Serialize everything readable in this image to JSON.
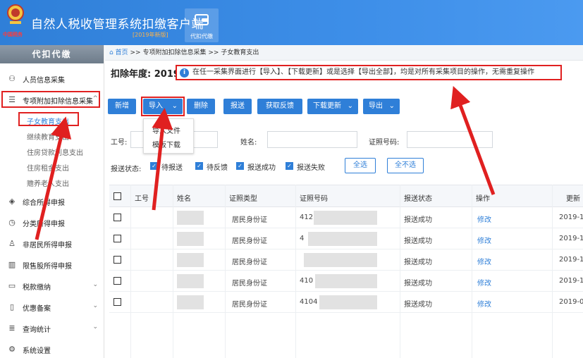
{
  "header": {
    "emblem_text": "中国税务",
    "title": "自然人税收管理系统扣缴客户端",
    "version_tag": "[2019年新版]",
    "module_label": "代扣代缴"
  },
  "sidebar": {
    "heading": "代扣代缴",
    "items": [
      {
        "label": "人员信息采集",
        "icon": "person-icon"
      },
      {
        "label": "专项附加扣除信息采集",
        "icon": "list-icon",
        "expanded": true
      },
      {
        "label": "综合所得申报",
        "icon": "layers-icon"
      },
      {
        "label": "分类所得申报",
        "icon": "clock-icon"
      },
      {
        "label": "非居民所得申报",
        "icon": "person-outline-icon"
      },
      {
        "label": "限售股所得申报",
        "icon": "bar-chart-icon"
      },
      {
        "label": "税款缴纳",
        "icon": "folder-icon"
      },
      {
        "label": "优惠备案",
        "icon": "document-icon"
      },
      {
        "label": "查询统计",
        "icon": "query-icon"
      },
      {
        "label": "系统设置",
        "icon": "gear-icon"
      }
    ],
    "sub_items": [
      "子女教育支出",
      "继续教育支出",
      "住房贷款利息支出",
      "住房租金支出",
      "赡养老人支出"
    ]
  },
  "breadcrumb": {
    "home": "首页",
    "sep1": ">>",
    "section": "专项附加扣除信息采集",
    "sep2": ">>",
    "page": "子女教育支出"
  },
  "year_label": "扣除年度: 2019",
  "notice": "在任一采集界面进行【导入】、【下载更新】或是选择【导出全部】，均是对所有采集项目的操作，无需重复操作",
  "toolbar": {
    "add": "新增",
    "import": "导入",
    "delete": "删除",
    "submit": "报送",
    "feedback": "获取反馈",
    "download": "下载更新",
    "export": "导出"
  },
  "import_menu": [
    "导入文件",
    "模板下载"
  ],
  "filters": {
    "emp_no_label": "工号:",
    "name_label": "姓名:",
    "id_no_label": "证照号码:",
    "status_label": "报送状态:",
    "statuses": [
      "待报送",
      "待反馈",
      "报送成功",
      "报送失败"
    ],
    "select_all": "全选",
    "select_none": "全不选"
  },
  "table": {
    "columns": [
      "工号",
      "姓名",
      "证照类型",
      "证照号码",
      "报送状态",
      "操作",
      "更新"
    ],
    "rows": [
      {
        "id_type": "居民身份证",
        "id_no": "412",
        "status": "报送成功",
        "action": "修改",
        "updated": "2019-1"
      },
      {
        "id_type": "居民身份证",
        "id_no": "4",
        "status": "报送成功",
        "action": "修改",
        "updated": "2019-1"
      },
      {
        "id_type": "居民身份证",
        "id_no": "",
        "status": "报送成功",
        "action": "修改",
        "updated": "2019-1"
      },
      {
        "id_type": "居民身份证",
        "id_no": "410",
        "status": "报送成功",
        "action": "修改",
        "updated": "2019-1"
      },
      {
        "id_type": "居民身份证",
        "id_no": "4104",
        "status": "报送成功",
        "action": "修改",
        "updated": "2019-0"
      }
    ]
  },
  "colors": {
    "brand_blue": "#2f7fd8",
    "highlight_red": "#e02020"
  }
}
